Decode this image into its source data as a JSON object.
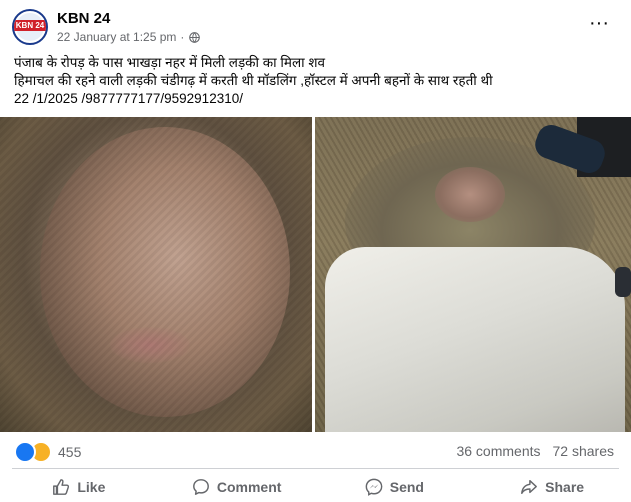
{
  "post": {
    "page_name": "KBN 24",
    "avatar_text": "KBN 24",
    "date": "22 January at 1:25 pm",
    "separator": "·",
    "privacy_icon": "globe-icon",
    "more_icon": "more-options-icon",
    "more_label": "···",
    "text_lines": [
      "पंजाब के रोपड़ के पास भाखड़ा नहर में मिली लड़की का मिला शव",
      "हिमाचल की रहने वाली लड़की चंडीगढ़ में करती थी मॉडलिंग ,हॉस्टल में अपनी बहनों के साथ रहती थी",
      "22 /1/2025 /9877777177/9592912310/"
    ]
  },
  "engagement": {
    "reaction_icons": [
      "like-reaction-icon",
      "sad-reaction-icon"
    ],
    "reaction_count": "455",
    "comments": "36 comments",
    "shares": "72 shares"
  },
  "actions": [
    {
      "label": "Like",
      "icon": "thumbs-up-icon"
    },
    {
      "label": "Comment",
      "icon": "comment-icon"
    },
    {
      "label": "Send",
      "icon": "messenger-icon"
    },
    {
      "label": "Share",
      "icon": "share-icon"
    }
  ],
  "colors": {
    "brand_blue": "#1877f2",
    "secondary_text": "#65676b",
    "divider": "#ced0d4"
  }
}
